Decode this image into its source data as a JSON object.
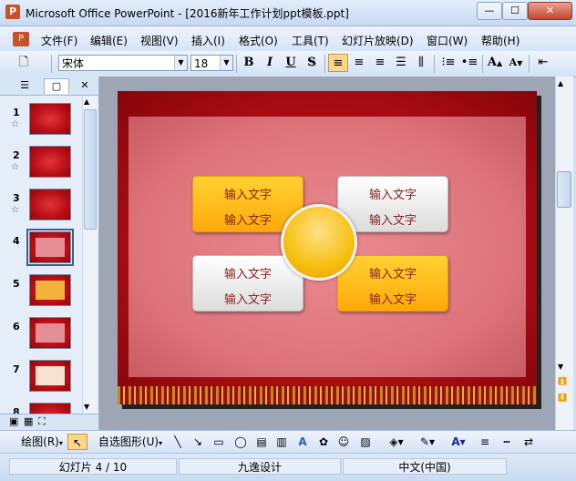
{
  "window": {
    "title": "Microsoft Office PowerPoint - [2016新年工作计划ppt模板.ppt]",
    "app_icon": "powerpoint-icon",
    "minimize_label": "—",
    "maximize_label": "☐",
    "close_label": "✕"
  },
  "menu": {
    "items": [
      "文件(F)",
      "编辑(E)",
      "视图(V)",
      "插入(I)",
      "格式(O)",
      "工具(T)",
      "幻灯片放映(D)",
      "窗口(W)",
      "帮助(H)"
    ]
  },
  "toolbar": {
    "font_name": "宋体",
    "font_size": "18",
    "bold_label": "B",
    "italic_label": "I",
    "underline_label": "U",
    "shadow_label": "S",
    "grow_font_label": "A",
    "shrink_font_label": "A"
  },
  "left_panel": {
    "close_label": "✕",
    "slide_numbers": [
      "1",
      "2",
      "3",
      "4",
      "5",
      "6",
      "7",
      "8"
    ],
    "selected_slide": 4
  },
  "slide": {
    "boxes": [
      {
        "line1": "输入文字",
        "line2": "输入文字"
      },
      {
        "line1": "输入文字",
        "line2": "输入文字"
      },
      {
        "line1": "输入文字",
        "line2": "输入文字"
      },
      {
        "line1": "输入文字",
        "line2": "输入文字"
      }
    ]
  },
  "draw_toolbar": {
    "draw_label": "绘图(R)",
    "autoshape_label": "自选图形(U)"
  },
  "status": {
    "slide_position": "幻灯片 4 / 10",
    "design_name": "九逸设计",
    "language": "中文(中国)"
  },
  "colors": {
    "slide_red": "#b90e16",
    "box_orange": "#ffb81a",
    "box_text": "#8a1e1e",
    "selection_blue": "#3a5f94"
  }
}
